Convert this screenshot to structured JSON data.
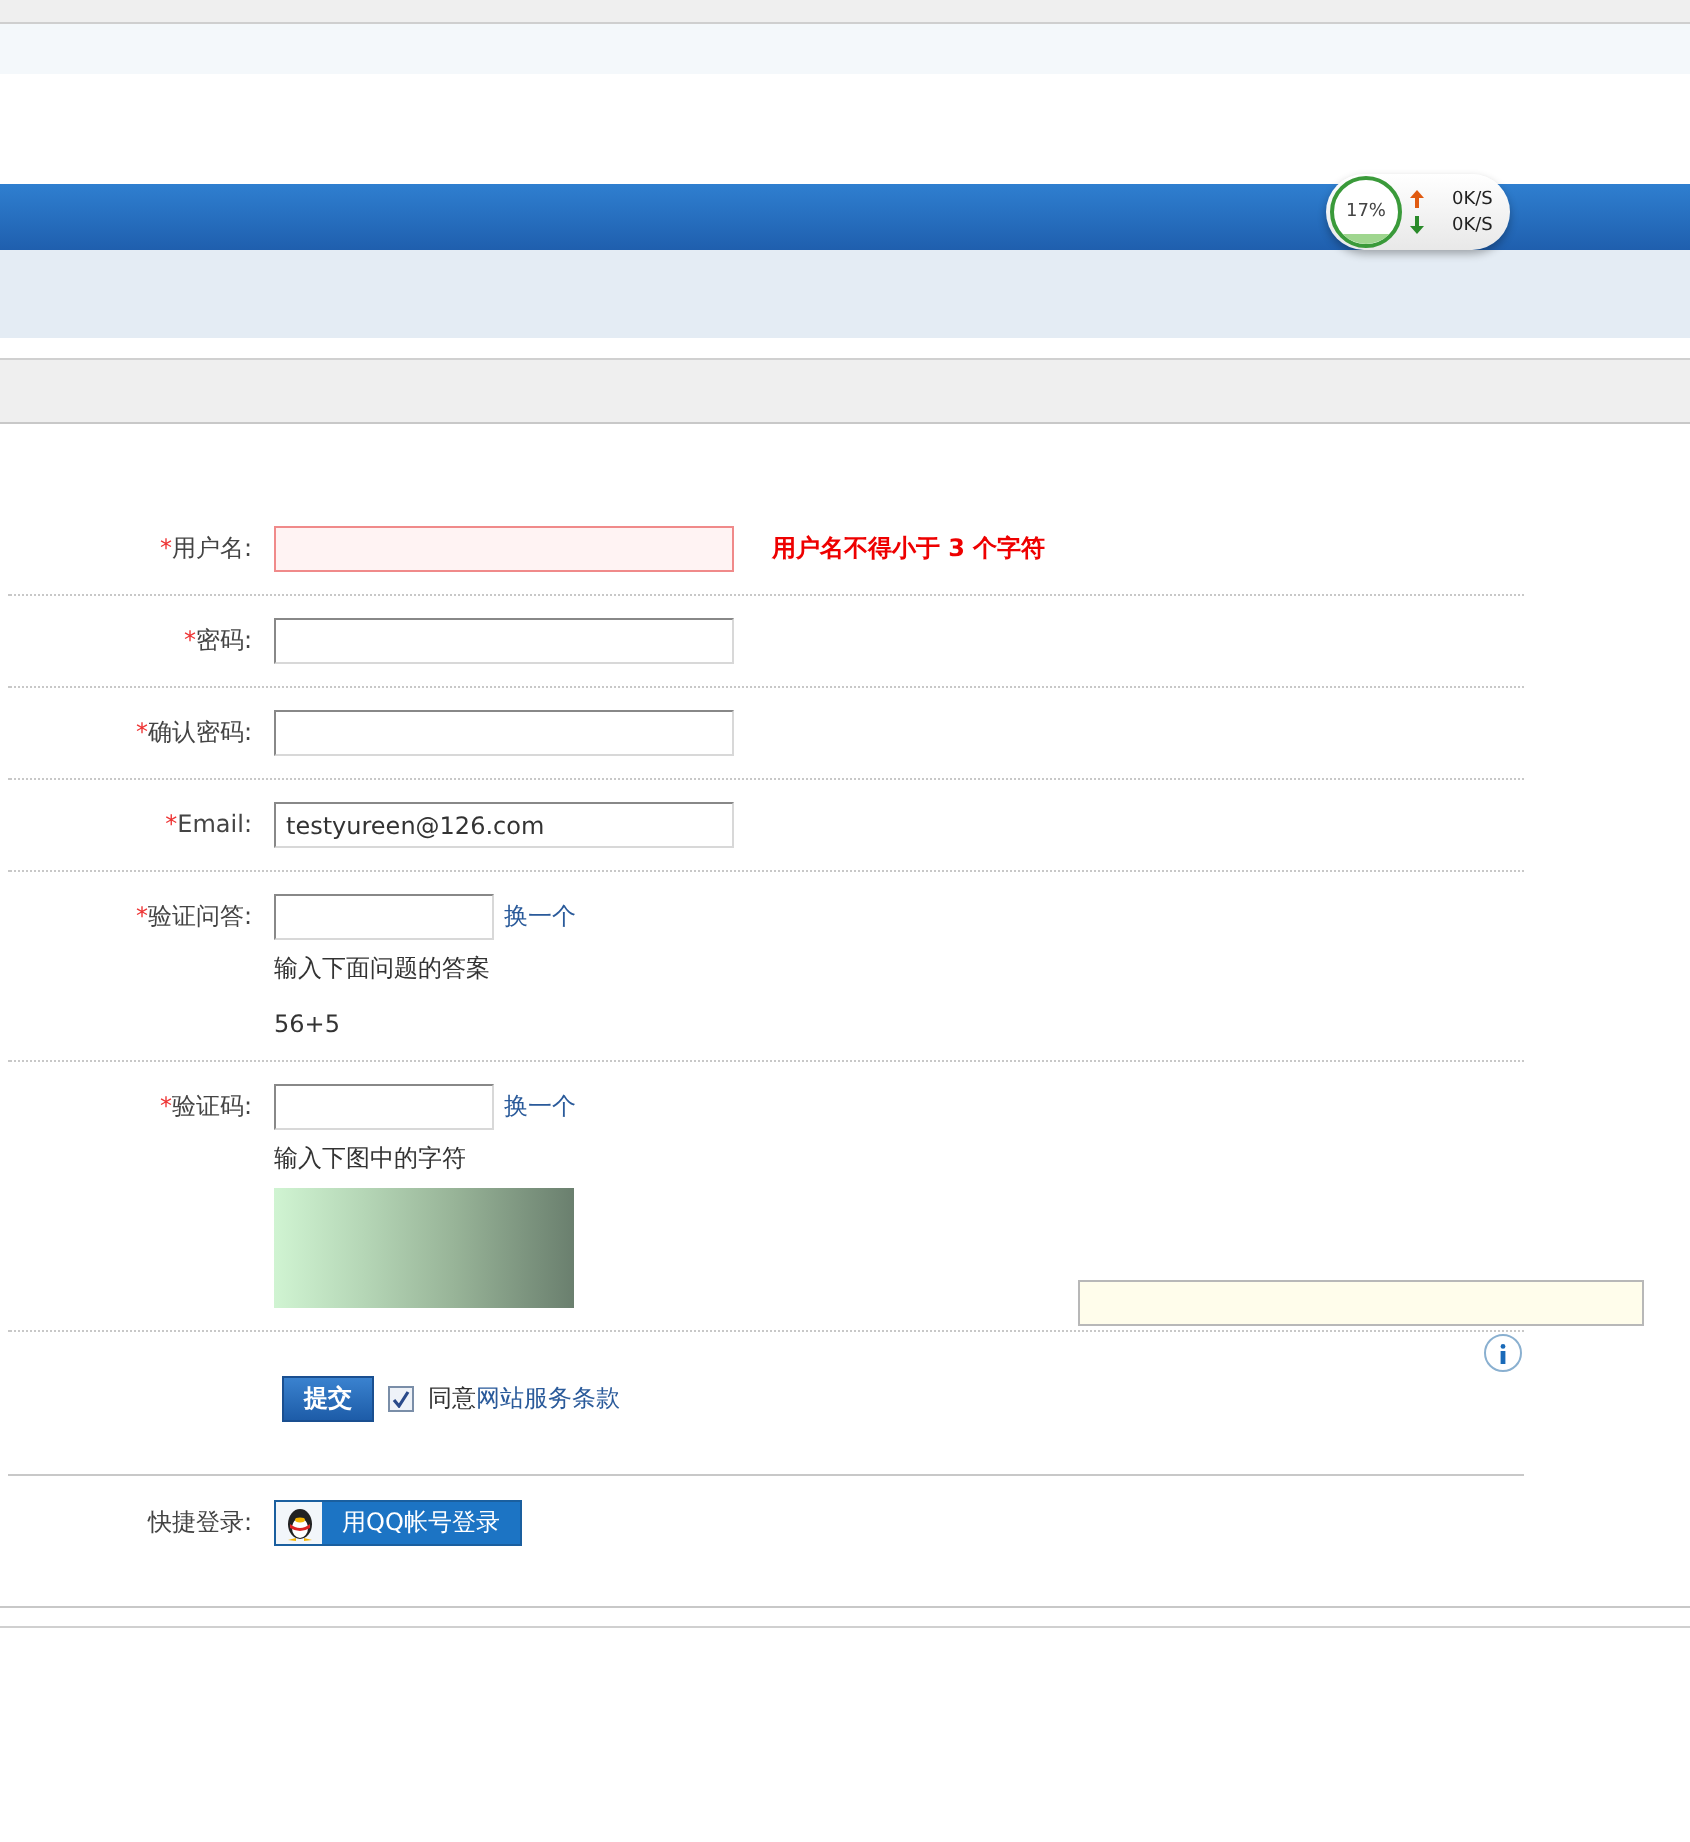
{
  "net_widget": {
    "reading": "17%",
    "upload": "0K/S",
    "download": "0K/S"
  },
  "form": {
    "fields": [
      {
        "kind": "text",
        "required_mark": "*",
        "label": "用户名:",
        "error": true,
        "error_text": "用户名不得小于 3 个字符"
      },
      {
        "kind": "text",
        "required_mark": "*",
        "label": "密码:",
        "error": false
      },
      {
        "kind": "text",
        "required_mark": "*",
        "label": "确认密码:",
        "error": false
      },
      {
        "kind": "text",
        "required_mark": "*",
        "label": "Email:",
        "value": "testyureen@126.com",
        "error": false
      },
      {
        "kind": "question",
        "required_mark": "*",
        "label": "验证问答:",
        "change_link": "换一个",
        "hint": "输入下面问题的答案",
        "question": "56+5"
      },
      {
        "kind": "captcha",
        "required_mark": "*",
        "label": "验证码:",
        "change_link": "换一个",
        "hint": "输入下图中的字符"
      }
    ],
    "submit": "提交",
    "agree": {
      "checked": true,
      "text": "同意",
      "link": "网站服务条款"
    },
    "quick_login": {
      "label": "快捷登录:",
      "button": "用QQ帐号登录"
    }
  }
}
